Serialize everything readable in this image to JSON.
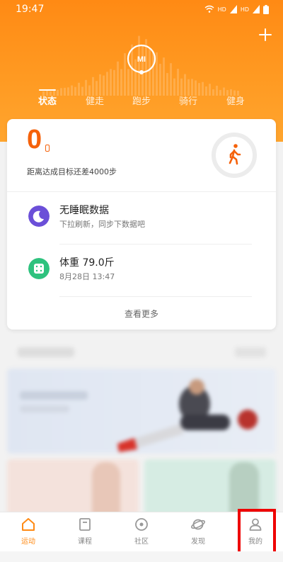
{
  "status_bar": {
    "time": "19:47",
    "net1": "HD",
    "net2": "HD"
  },
  "header": {
    "logo_text": "MI",
    "tabs": [
      {
        "label": "状态",
        "active": true
      },
      {
        "label": "健走",
        "active": false
      },
      {
        "label": "跑步",
        "active": false
      },
      {
        "label": "骑行",
        "active": false
      },
      {
        "label": "健身",
        "active": false
      }
    ]
  },
  "summary_card": {
    "steps": "0",
    "goal_text": "距离达成目标还差4000步",
    "sleep": {
      "title": "无睡眠数据",
      "subtitle": "下拉刷新，同步下数据吧"
    },
    "weight": {
      "title": "体重  79.0斤",
      "subtitle": "8月28日  13:47"
    },
    "more_label": "查看更多"
  },
  "bottom_nav": [
    {
      "label": "运动",
      "icon": "home-icon",
      "active": true
    },
    {
      "label": "课程",
      "icon": "course-icon",
      "active": false
    },
    {
      "label": "社区",
      "icon": "community-icon",
      "active": false
    },
    {
      "label": "发现",
      "icon": "discover-icon",
      "active": false
    },
    {
      "label": "我的",
      "icon": "profile-icon",
      "active": false
    }
  ],
  "colors": {
    "accent": "#ff8a14",
    "steps": "#f5620b",
    "sleep_icon": "#6b4fd8",
    "weight_icon": "#2ec27e",
    "highlight": "#e00000"
  }
}
